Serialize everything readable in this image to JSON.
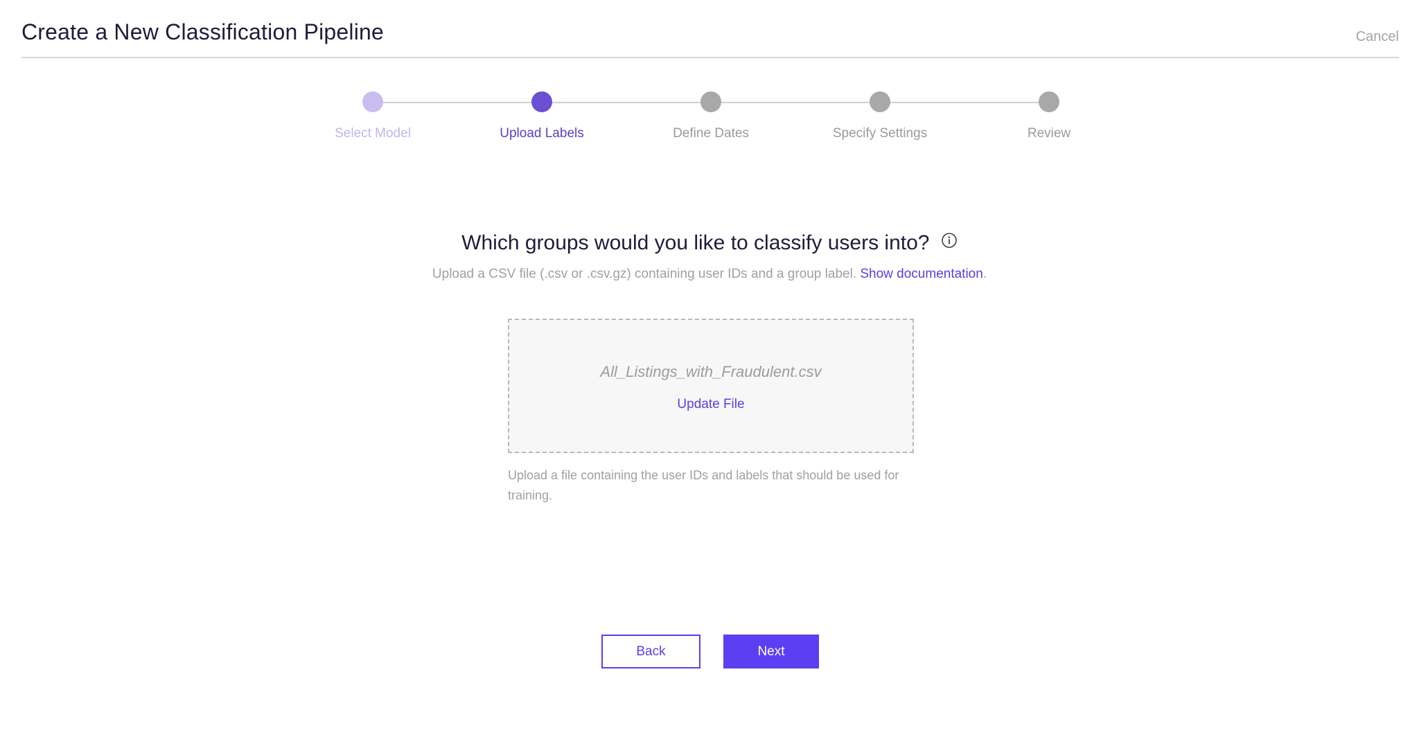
{
  "header": {
    "title": "Create a New Classification Pipeline",
    "cancel_label": "Cancel"
  },
  "stepper": {
    "steps": [
      {
        "label": "Select Model",
        "state": "completed"
      },
      {
        "label": "Upload Labels",
        "state": "active"
      },
      {
        "label": "Define Dates",
        "state": "pending"
      },
      {
        "label": "Specify Settings",
        "state": "pending"
      },
      {
        "label": "Review",
        "state": "pending"
      }
    ]
  },
  "main": {
    "question": "Which groups would you like to classify users into?",
    "info_icon": "info-circle-icon",
    "subtitle_text": "Upload a CSV file (.csv or .csv.gz) containing user IDs and a group label.",
    "doc_link": "Show documentation",
    "subtitle_end": ".",
    "upload": {
      "file_name": "All_Listings_with_Fraudulent.csv",
      "update_label": "Update File",
      "helper_text": "Upload a file containing the user IDs and labels that should be used for training."
    }
  },
  "footer": {
    "back_label": "Back",
    "next_label": "Next"
  },
  "colors": {
    "accent": "#5b3ff0",
    "active_step": "#6a4fd2",
    "completed_step": "#c9bdef",
    "pending_step": "#a8a8a8",
    "dropzone_bg": "#f6f7f6"
  }
}
